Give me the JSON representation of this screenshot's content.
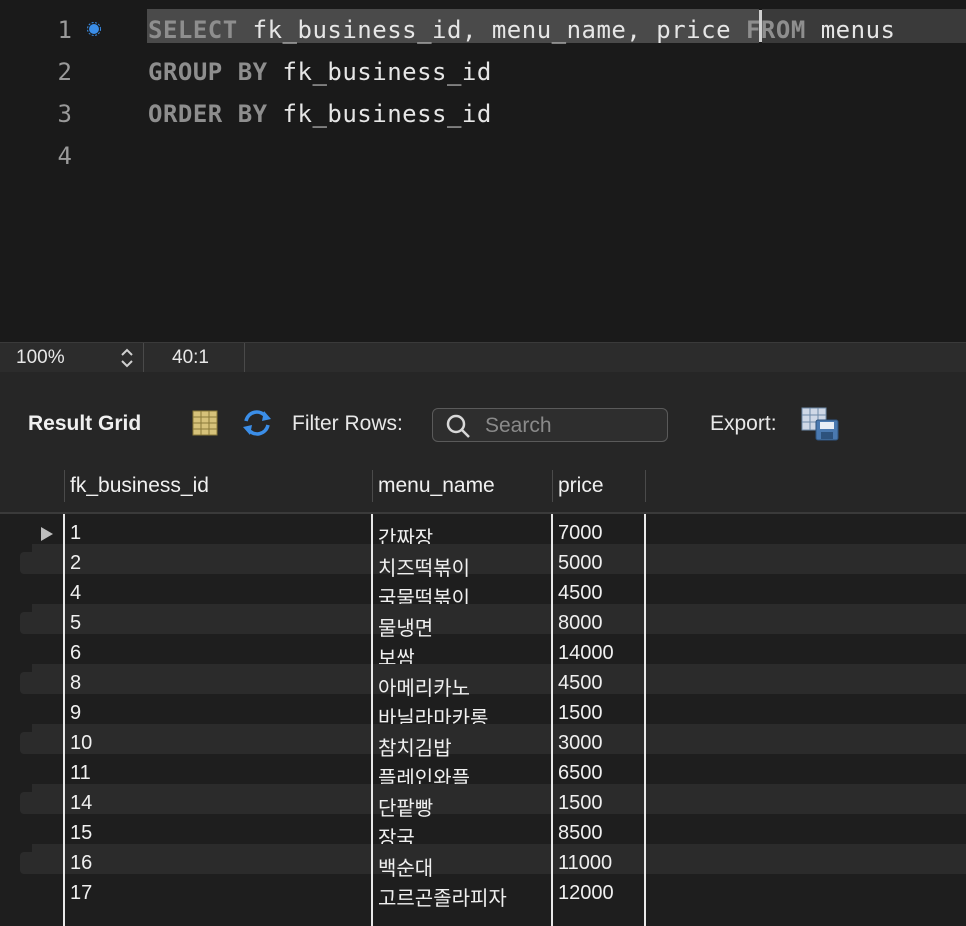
{
  "editor": {
    "lines": [
      {
        "num": "1",
        "parts": [
          [
            "kw",
            "SELECT"
          ],
          [
            "id",
            " fk_business_id, menu_name, price"
          ],
          [
            "kw",
            " FROM"
          ],
          [
            "id",
            " menus"
          ]
        ]
      },
      {
        "num": "2",
        "parts": [
          [
            "kw",
            "GROUP BY"
          ],
          [
            "id",
            " fk_business_id"
          ]
        ]
      },
      {
        "num": "3",
        "parts": [
          [
            "kw",
            "ORDER BY"
          ],
          [
            "id",
            " fk_business_id"
          ]
        ]
      },
      {
        "num": "4",
        "parts": []
      }
    ]
  },
  "status": {
    "zoom": "100%",
    "cursor": "40:1"
  },
  "toolbar": {
    "result_grid": "Result Grid",
    "filter_rows": "Filter Rows:",
    "search_placeholder": "Search",
    "export": "Export:"
  },
  "grid": {
    "columns": [
      "fk_business_id",
      "menu_name",
      "price"
    ],
    "rows": [
      [
        "1",
        "간짜장",
        "7000"
      ],
      [
        "2",
        "치즈떡볶이",
        "5000"
      ],
      [
        "4",
        "국물떡볶이",
        "4500"
      ],
      [
        "5",
        "물냉면",
        "8000"
      ],
      [
        "6",
        "보쌈",
        "14000"
      ],
      [
        "8",
        "아메리카노",
        "4500"
      ],
      [
        "9",
        "바닐라마카롱",
        "1500"
      ],
      [
        "10",
        "참치김밥",
        "3000"
      ],
      [
        "11",
        "플레인와플",
        "6500"
      ],
      [
        "14",
        "단팥빵",
        "1500"
      ],
      [
        "15",
        "장국",
        "8500"
      ],
      [
        "16",
        "백순대",
        "11000"
      ],
      [
        "17",
        "고르곤졸라피자",
        "12000"
      ]
    ]
  },
  "colors": {
    "keyword": "#8e8e8e",
    "selection": "#4a4a4a",
    "accent": "#3b8ee8"
  }
}
